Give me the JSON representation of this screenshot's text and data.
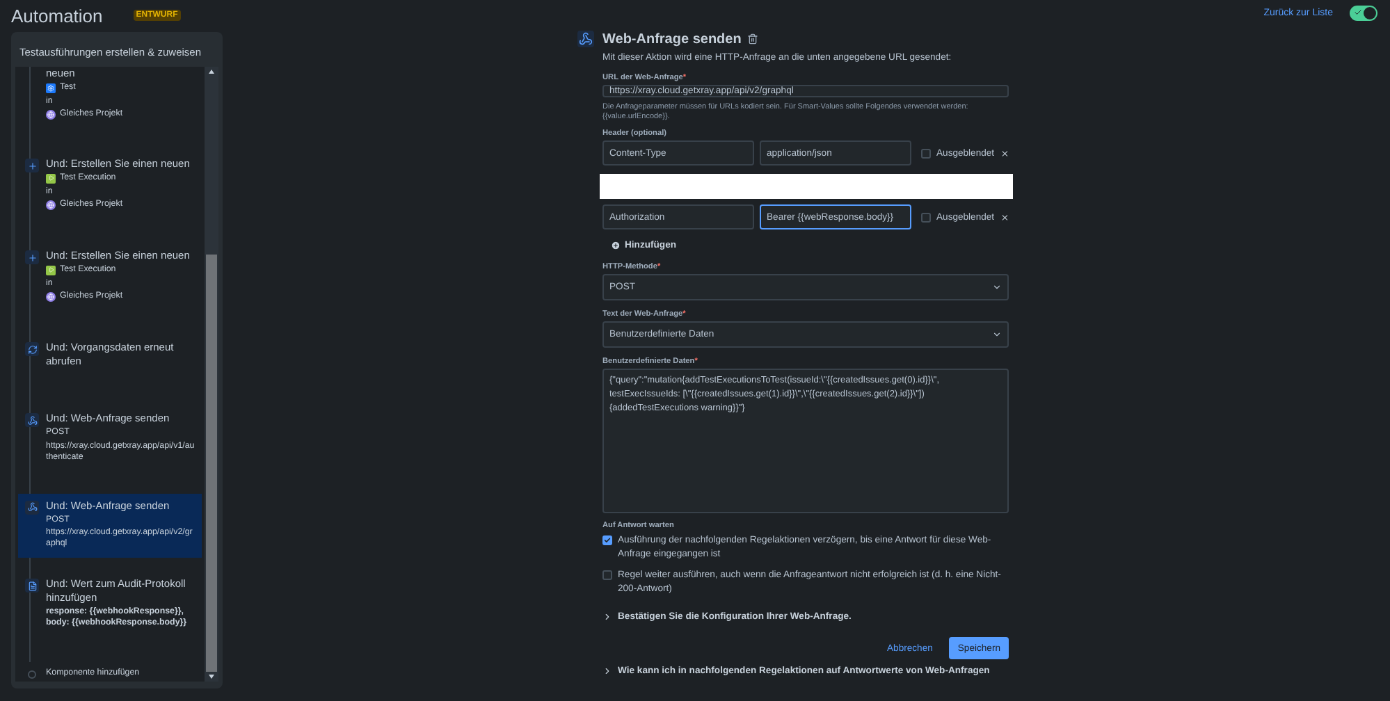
{
  "app": {
    "title": "Automation",
    "badge": "ENTWURF",
    "back_link": "Zurück zur Liste",
    "enabled_toggle": {
      "on": true
    }
  },
  "sidebar": {
    "title": "Testausführungen erstellen & zuweisen",
    "items": [
      {
        "kind": "continued",
        "title": "neuen",
        "issue_type": {
          "kind": "test",
          "label": "Test"
        },
        "connector": "in",
        "project": "Gleiches Projekt",
        "selected": false
      },
      {
        "kind": "create",
        "title": "Und: Erstellen Sie einen neuen",
        "issue_type": {
          "kind": "execution",
          "label": "Test Execution"
        },
        "connector": "in",
        "project": "Gleiches Projekt",
        "selected": false
      },
      {
        "kind": "create",
        "title": "Und: Erstellen Sie einen neuen",
        "issue_type": {
          "kind": "execution",
          "label": "Test Execution"
        },
        "connector": "in",
        "project": "Gleiches Projekt",
        "selected": false
      },
      {
        "kind": "refetch",
        "title": "Und: Vorgangsdaten erneut abrufen",
        "selected": false
      },
      {
        "kind": "web",
        "title": "Und: Web-Anfrage senden",
        "method": "POST",
        "url": "https://xray.cloud.getxray.app/api/v1/authenticate",
        "selected": false
      },
      {
        "kind": "web",
        "title": "Und: Web-Anfrage senden",
        "method": "POST",
        "url": "https://xray.cloud.getxray.app/api/v2/graphql",
        "selected": true
      },
      {
        "kind": "log",
        "title": "Und: Wert zum Audit-Protokoll hinzufügen",
        "details": "response: {{webhookResponse}}, body: {{webhookResponse.body}}",
        "selected": false
      },
      {
        "kind": "add",
        "title": "Komponente hinzufügen",
        "selected": false
      }
    ]
  },
  "form": {
    "title": "Web-Anfrage senden",
    "description": "Mit dieser Aktion wird eine HTTP-Anfrage an die unten angegebene URL gesendet:",
    "url": {
      "label": "URL der Web-Anfrage",
      "required_mark": "*",
      "value": "https://xray.cloud.getxray.app/api/v2/graphql",
      "hint": "Die Anfrageparameter müssen für URLs kodiert sein. Für Smart-Values sollte Folgendes verwendet werden: {{value.urlEncode}}."
    },
    "headers": {
      "label": "Header (optional)",
      "add_label": "Hinzufügen",
      "rows": [
        {
          "kind": "header",
          "name": "Content-Type",
          "value": "application/json",
          "hidden_label": "Ausgeblendet",
          "hidden": false,
          "focused": false
        },
        {
          "kind": "redacted"
        },
        {
          "kind": "header",
          "name": "Authorization",
          "value": "Bearer {{webResponse.body}}",
          "hidden_label": "Ausgeblendet",
          "hidden": false,
          "focused": true
        }
      ]
    },
    "method": {
      "label": "HTTP-Methode",
      "required_mark": "*",
      "value": "POST"
    },
    "body_type": {
      "label": "Text der Web-Anfrage",
      "required_mark": "*",
      "value": "Benutzerdefinierte Daten"
    },
    "custom_data": {
      "label": "Benutzerdefinierte Daten",
      "required_mark": "*",
      "value": "{\"query\":\"mutation{addTestExecutionsToTest(issueId:\\\"{{createdIssues.get(0).id}}\\\", testExecIssueIds: [\\\"{{createdIssues.get(1).id}}\\\",\\\"{{createdIssues.get(2).id}}\\\"]){addedTestExecutions warning}}\"}"
    },
    "wait": {
      "label": "Auf Antwort warten",
      "options": [
        {
          "label": "Ausführung der nachfolgenden Regelaktionen verzögern, bis eine Antwort für diese Web-Anfrage eingegangen ist",
          "checked": true
        },
        {
          "label": "Regel weiter ausführen, auch wenn die Anfrageantwort nicht erfolgreich ist (d. h. eine Nicht-200-Antwort)",
          "checked": false
        }
      ]
    },
    "confirm": {
      "label": "Bestätigen Sie die Konfiguration Ihrer Web-Anfrage.",
      "expanded": false
    },
    "buttons": [
      {
        "kind": "subtle",
        "label": "Abbrechen"
      },
      {
        "kind": "primary",
        "label": "Speichern"
      }
    ],
    "faq": {
      "label": "Wie kann ich in nachfolgenden Regelaktionen auf Antwortwerte von Web-Anfragen",
      "expanded": false
    }
  }
}
